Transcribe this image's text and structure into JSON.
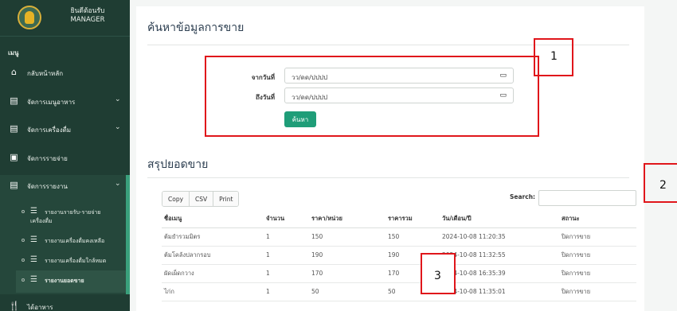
{
  "brand": {
    "line1": "ยินดีต้อนรับ",
    "line2": "MANAGER"
  },
  "sidebar": {
    "menu_header": "เมนู",
    "items": [
      {
        "label": "กลับหน้าหลัก",
        "icon": "home-icon"
      },
      {
        "label": "จัดการเมนูอาหาร",
        "icon": "document-icon"
      },
      {
        "label": "จัดการเครื่องดื่ม",
        "icon": "document-icon"
      },
      {
        "label": "จัดการรายจ่าย",
        "icon": "money-icon"
      },
      {
        "label": "จัดการรายงาน",
        "icon": "document-icon"
      }
    ],
    "subitems": [
      {
        "label_line1": "รายงานรายรับ-รายจ่าย",
        "label_line2": "เครื่องดื่ม"
      },
      {
        "label_line1": "รายงานเครื่องดื่มคงเหลือ",
        "label_line2": ""
      },
      {
        "label_line1": "รายงานเครื่องดื่มใกล้หมด",
        "label_line2": ""
      },
      {
        "label_line1": "รายงานยอดขาย",
        "label_line2": ""
      }
    ],
    "last_item": {
      "label": "ได้อาหาร",
      "icon": "utensils-icon"
    }
  },
  "search_section": {
    "title": "ค้นหาข้อมูลการขาย",
    "from_label": "จากวันที่",
    "to_label": "ถึงวันที่",
    "from_value": "วว/ดด/ปปปป",
    "to_value": "วว/ดด/ปปปป",
    "button": "ค้นหา"
  },
  "summary_section": {
    "title": "สรุปยอดขาย",
    "buttons": [
      "Copy",
      "CSV",
      "Print"
    ],
    "search_label": "Search:"
  },
  "table": {
    "headers": [
      "ชื่อเมนู",
      "จำนวน",
      "ราคา/หน่วย",
      "ราคารวม",
      "วัน/เดือน/ปี",
      "สถานะ"
    ],
    "rows": [
      [
        "ต้มยำรวมมิตร",
        "1",
        "150",
        "150",
        "2024-10-08 11:20:35",
        "ปิดการขาย"
      ],
      [
        "ต้มโคล้งปลากรอบ",
        "1",
        "190",
        "190",
        "2024-10-08 11:32:55",
        "ปิดการขาย"
      ],
      [
        "ผัดเผ็ดกวาง",
        "1",
        "170",
        "170",
        "2024-10-08 16:35:39",
        "ปิดการขาย"
      ],
      [
        "ไก่ก",
        "1",
        "50",
        "50",
        "2024-10-08 11:35:01",
        "ปิดการขาย"
      ]
    ]
  },
  "callouts": [
    "1",
    "2",
    "3"
  ],
  "colors": {
    "sidebar": "#1f3d33",
    "accent": "#3aa07c",
    "button": "#1f9d78",
    "callout": "#e0161b"
  }
}
